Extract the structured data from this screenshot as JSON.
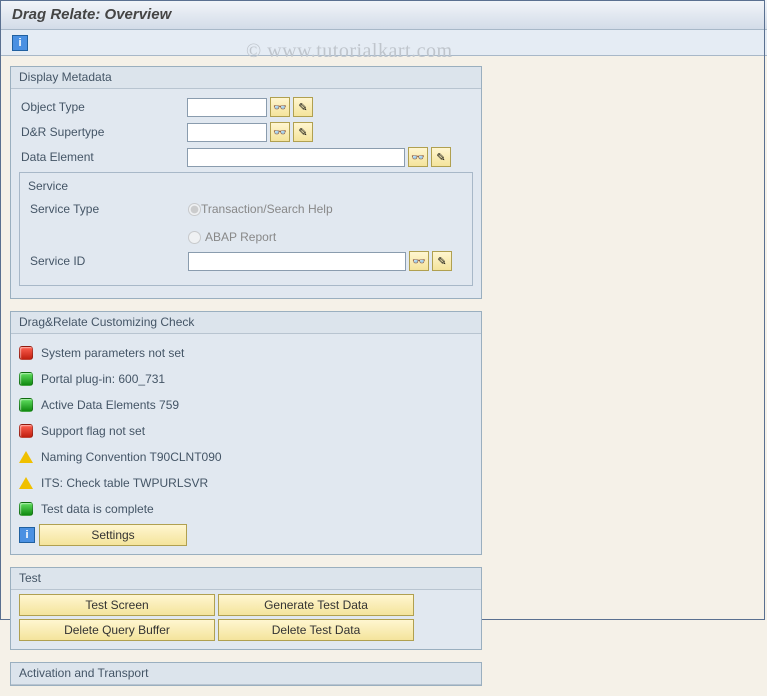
{
  "title": "Drag Relate: Overview",
  "watermark": "© www.tutorialkart.com",
  "panels": {
    "metadata": {
      "title": "Display Metadata",
      "objectType": {
        "label": "Object Type",
        "value": ""
      },
      "supertype": {
        "label": "D&R Supertype",
        "value": ""
      },
      "dataElement": {
        "label": "Data Element",
        "value": ""
      },
      "service": {
        "title": "Service",
        "typeLabel": "Service Type",
        "radio1": "Transaction/Search Help",
        "radio2": "ABAP Report",
        "idLabel": "Service ID",
        "idValue": ""
      }
    },
    "check": {
      "title": "Drag&Relate Customizing Check",
      "items": [
        {
          "status": "red",
          "text": "System parameters not set"
        },
        {
          "status": "green",
          "text": "Portal plug-in: 600_731"
        },
        {
          "status": "green",
          "text": "Active Data Elements 759"
        },
        {
          "status": "red",
          "text": "Support flag not set"
        },
        {
          "status": "yellow",
          "text": "Naming Convention T90CLNT090"
        },
        {
          "status": "yellow",
          "text": "ITS: Check table TWPURLSVR"
        },
        {
          "status": "green",
          "text": "Test data is complete"
        }
      ],
      "settings": "Settings"
    },
    "test": {
      "title": "Test",
      "buttons": {
        "testScreen": "Test Screen",
        "generateTestData": "Generate Test Data",
        "deleteQueryBuffer": "Delete Query Buffer",
        "deleteTestData": "Delete Test Data"
      }
    },
    "activation": {
      "title": "Activation and Transport"
    }
  }
}
